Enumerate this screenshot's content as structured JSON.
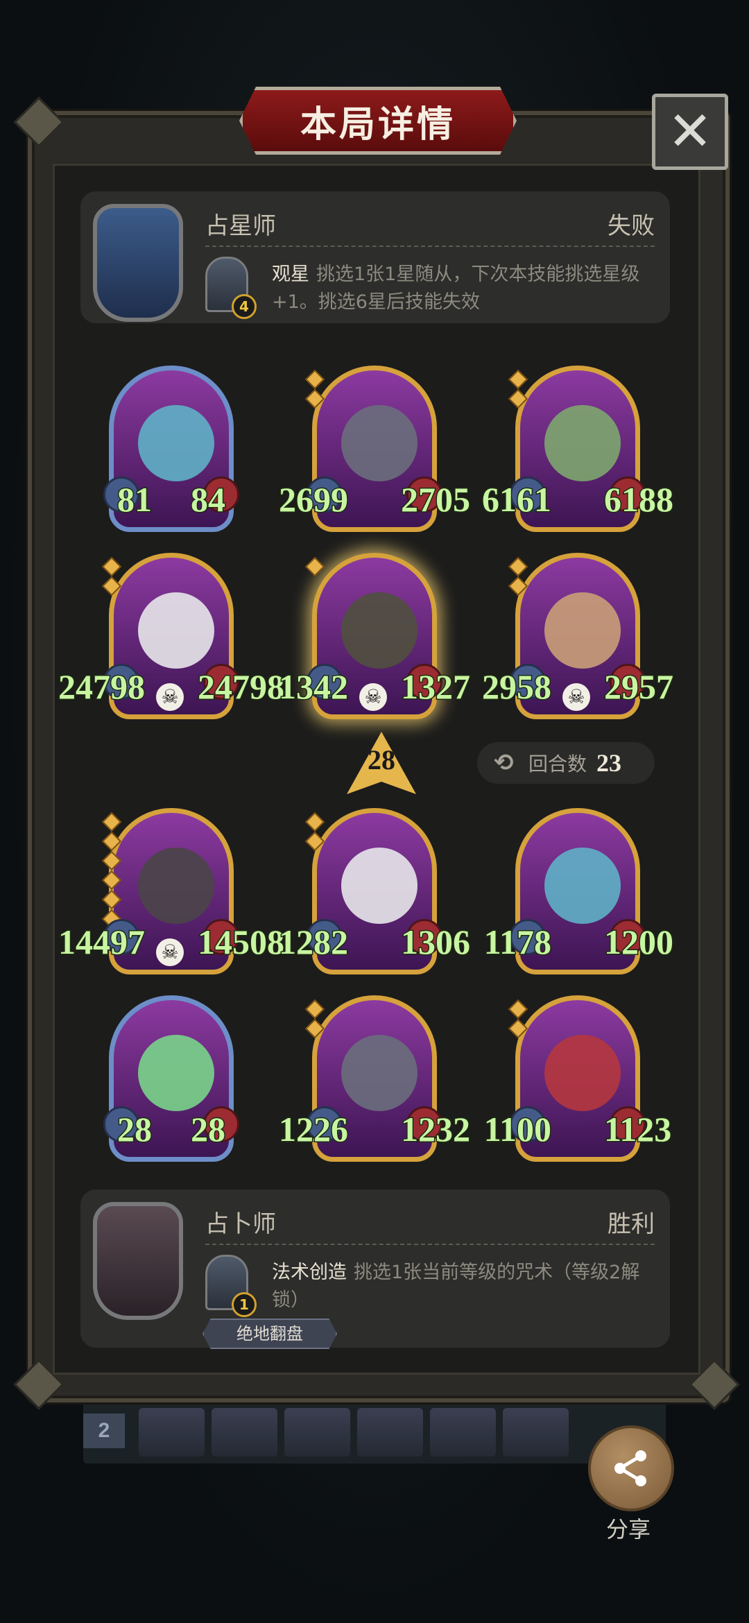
{
  "title": "本局详情",
  "close_glyph": "✕",
  "background_strip_number": "2",
  "top_player": {
    "name": "占星师",
    "result": "失败",
    "skill_level": "4",
    "skill_name": "观星",
    "skill_desc": "挑选1张1星随从，下次本技能挑选星级+1。挑选6星后技能失效"
  },
  "round_top": [
    {
      "atk": "81",
      "hp": "84",
      "frame": "blue"
    },
    {
      "atk": "2699",
      "hp": "2705",
      "frame": "gold"
    },
    {
      "atk": "6161",
      "hp": "6188",
      "frame": "gold"
    },
    {
      "atk": "24798",
      "hp": "24798",
      "frame": "gold",
      "skull": true
    },
    {
      "atk": "1342",
      "hp": "1327",
      "frame": "gold",
      "skull": true,
      "glow": true
    },
    {
      "atk": "2958",
      "hp": "2957",
      "frame": "gold",
      "skull": true
    }
  ],
  "tavern_tier": "28",
  "round_count_label": "回合数",
  "round_count": "23",
  "round_bottom": [
    {
      "atk": "14497",
      "hp": "14508",
      "frame": "gold",
      "skull": true
    },
    {
      "atk": "1282",
      "hp": "1306",
      "frame": "gold"
    },
    {
      "atk": "1178",
      "hp": "1200",
      "frame": "gold"
    },
    {
      "atk": "28",
      "hp": "28",
      "frame": "blue"
    },
    {
      "atk": "1226",
      "hp": "1232",
      "frame": "gold"
    },
    {
      "atk": "1100",
      "hp": "1123",
      "frame": "gold"
    }
  ],
  "bottom_player": {
    "name": "占卜师",
    "result": "胜利",
    "skill_level": "1",
    "skill_name": "法术创造",
    "skill_desc": "挑选1张当前等级的咒术（等级2解锁）",
    "badge": "绝地翻盘"
  },
  "share_label": "分享",
  "skull_glyph": "☠"
}
